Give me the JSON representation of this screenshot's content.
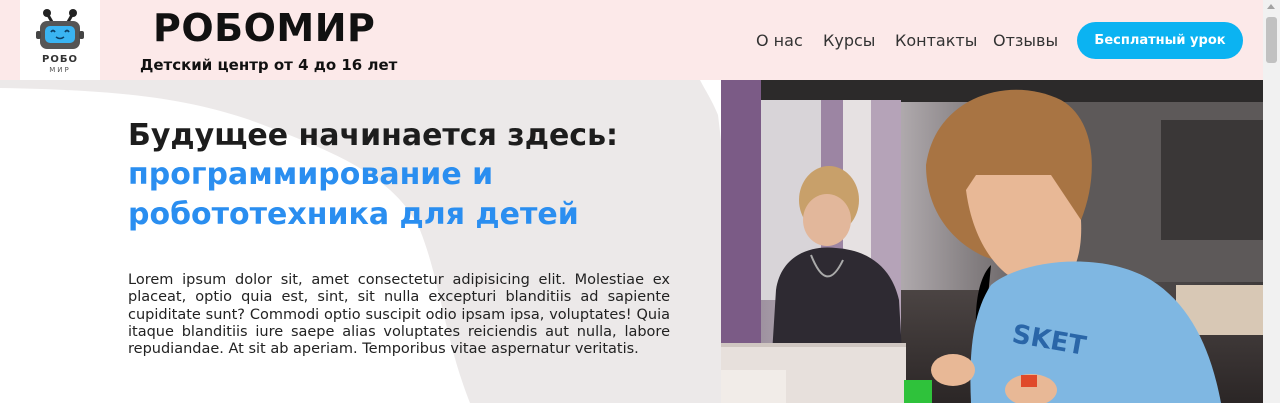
{
  "header": {
    "logo": {
      "line1": "РОБО",
      "line2": "МИР",
      "icon": "robot-logo-icon"
    },
    "title": "РОБОМИР",
    "subtitle": "Детский центр от 4 до 16 лет",
    "nav": [
      "О нас",
      "Курсы",
      "Контакты",
      "Отзывы"
    ],
    "cta": "Бесплатный урок"
  },
  "hero": {
    "heading_line1": "Будущее начинается здесь:",
    "heading_line2": "программирование и",
    "heading_line3": "робототехника для детей",
    "text": "Lorem ipsum dolor sit, amet consectetur adipisicing elit. Molestiae ex placeat, optio quia est, sint, sit nulla excepturi blanditiis ad sapiente cupiditate sunt? Commodi optio suscipit odio ipsam ipsa, voluptates! Quia itaque blanditiis iure saepe alias voluptates reiciendis aut nulla, labore repudiandae. At sit ab aperiam. Temporibus vitae aspernatur veritatis.",
    "photo": "children-building-robots-photo"
  },
  "colors": {
    "header_bg": "#fce9e9",
    "accent_blue": "#2a8ef0",
    "button_blue": "#0bb3f2",
    "hero_shape": "#ece9e9"
  }
}
